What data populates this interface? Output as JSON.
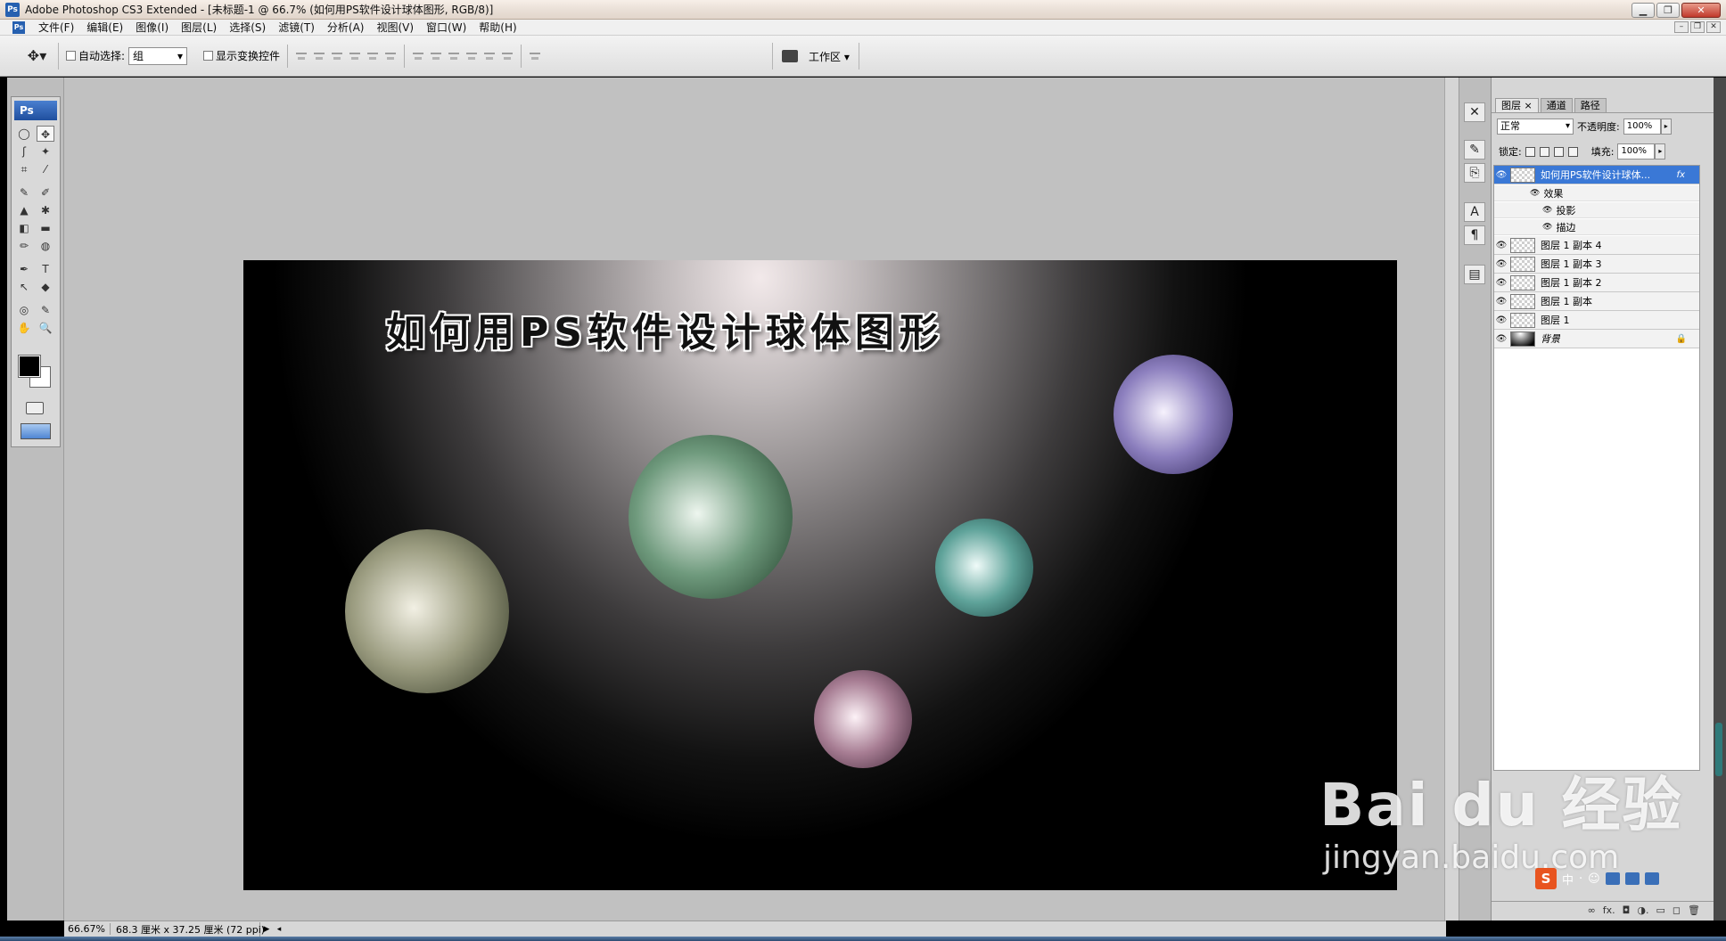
{
  "window": {
    "app_icon": "Ps",
    "title": "Adobe Photoshop CS3 Extended - [未标题-1 @ 66.7% (如何用PS软件设计球体图形, RGB/8)]",
    "controls": {
      "minimize": "▁",
      "maximize": "❐",
      "close": "✕"
    }
  },
  "menu": {
    "items": [
      "文件(F)",
      "编辑(E)",
      "图像(I)",
      "图层(L)",
      "选择(S)",
      "滤镜(T)",
      "分析(A)",
      "视图(V)",
      "窗口(W)",
      "帮助(H)"
    ],
    "doc_controls": [
      "–",
      "❐",
      "✕"
    ]
  },
  "options": {
    "tool_icon": "move-tool-icon",
    "auto_select_label": "自动选择:",
    "auto_select_value": "组",
    "show_transform_label": "显示变换控件",
    "workspace_label": "工作区 ▾"
  },
  "canvas": {
    "title_text": "如何用PS软件设计球体图形",
    "spheres": [
      {
        "name": "sphere-olive",
        "center": "#f2f0e4",
        "mid": "#9b9c80",
        "edge": "#2d3320"
      },
      {
        "name": "sphere-green",
        "center": "#eef6ef",
        "mid": "#6f9a7d",
        "edge": "#1c3a25"
      },
      {
        "name": "sphere-teal",
        "center": "#f0fbf9",
        "mid": "#5fa39a",
        "edge": "#153f3c"
      },
      {
        "name": "sphere-pink",
        "center": "#fdf2f7",
        "mid": "#a77d93",
        "edge": "#3a2032"
      },
      {
        "name": "sphere-purple",
        "center": "#f6f2fd",
        "mid": "#8c7fbe",
        "edge": "#2c2357"
      }
    ]
  },
  "toolbox": {
    "logo": "Ps",
    "tools": [
      "◯",
      "✥",
      "ʃ",
      "✦",
      "⌗",
      "⁄",
      "✎",
      "✐",
      "▲",
      "✱",
      "◧",
      "▬",
      "✏",
      "◍",
      "✒",
      "T",
      "↖",
      "◆",
      "◎",
      "✎",
      "✋",
      "🔍"
    ]
  },
  "layers": {
    "tabs": [
      "图层 ×",
      "通道",
      "路径"
    ],
    "blend_mode": "正常",
    "opacity_label": "不透明度:",
    "opacity_value": "100%",
    "lock_label": "锁定:",
    "fill_label": "填充:",
    "fill_value": "100%",
    "rows": [
      {
        "name": "如何用PS软件设计球体...",
        "fx": "fx",
        "selected": true
      },
      {
        "name": "图层 1 副本 4"
      },
      {
        "name": "图层 1 副本 3"
      },
      {
        "name": "图层 1 副本 2"
      },
      {
        "name": "图层 1 副本"
      },
      {
        "name": "图层 1"
      },
      {
        "name": "背景",
        "locked": "🔒"
      }
    ],
    "effects_label": "效果",
    "effects": [
      "投影",
      "描边"
    ],
    "bottom_icons": [
      "∞",
      "fx.",
      "◘",
      "◑.",
      "▭",
      "◻",
      "🗑"
    ]
  },
  "status": {
    "zoom": "66.67%",
    "doc_info": "68.3 厘米 x 37.25 厘米 (72 ppi)"
  },
  "watermark": {
    "big": "Bai du 经验",
    "small": "jingyan.baidu.com"
  },
  "ime": {
    "logo": "S",
    "items": [
      "中",
      "·",
      "☺"
    ]
  }
}
